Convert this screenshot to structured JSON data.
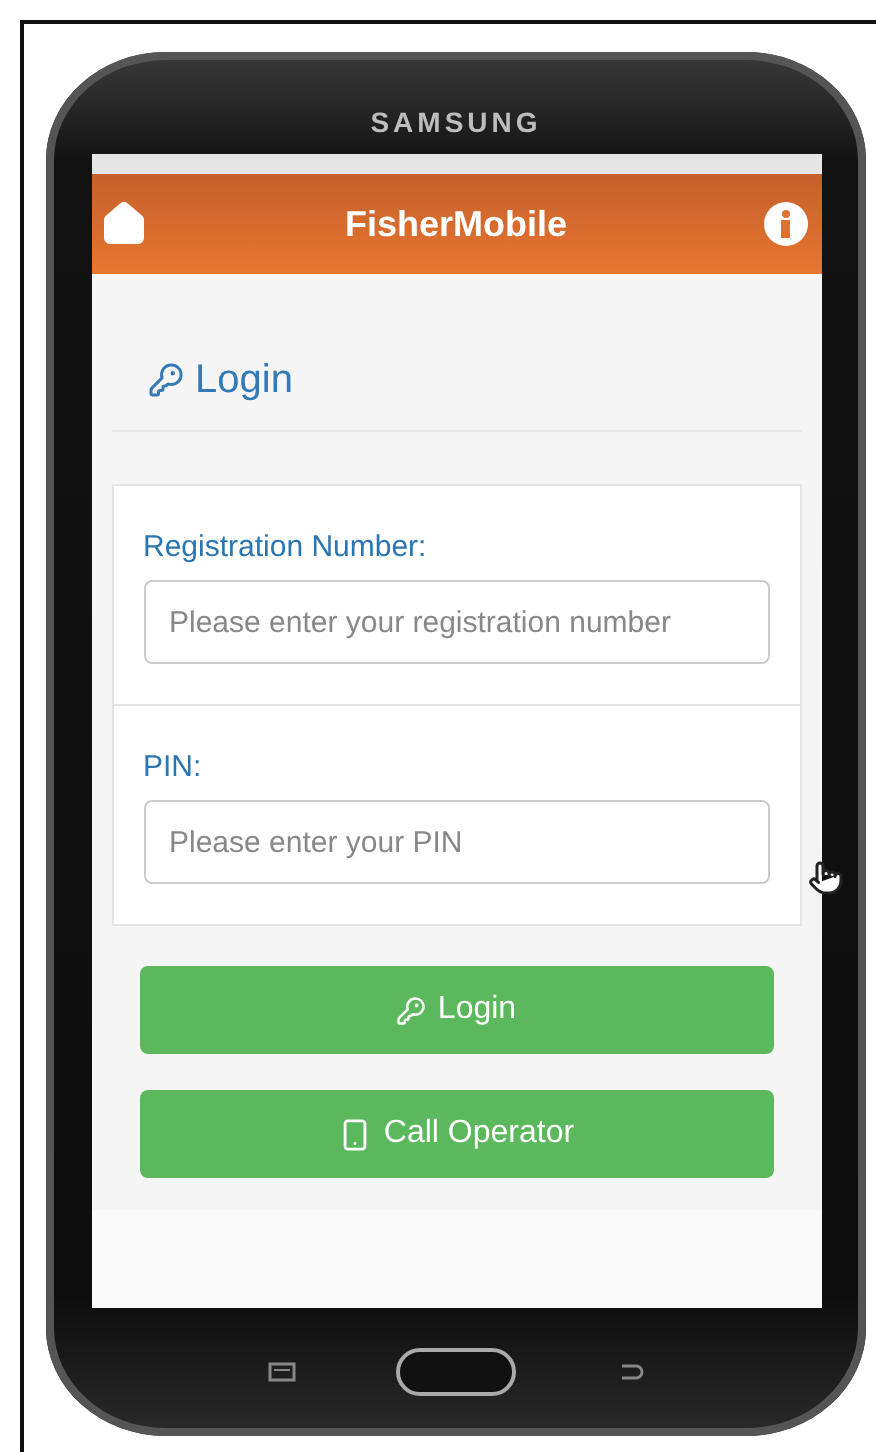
{
  "device": {
    "brand": "SAMSUNG"
  },
  "header": {
    "title": "FisherMobile"
  },
  "page_title": "Login",
  "fields": [
    {
      "label": "Registration Number:",
      "placeholder": "Please enter your registration number"
    },
    {
      "label": "PIN:",
      "placeholder": "Please enter your PIN"
    }
  ],
  "buttons": [
    {
      "label": "Login",
      "kind": "login"
    },
    {
      "label": "Call Operator",
      "kind": "call"
    }
  ]
}
